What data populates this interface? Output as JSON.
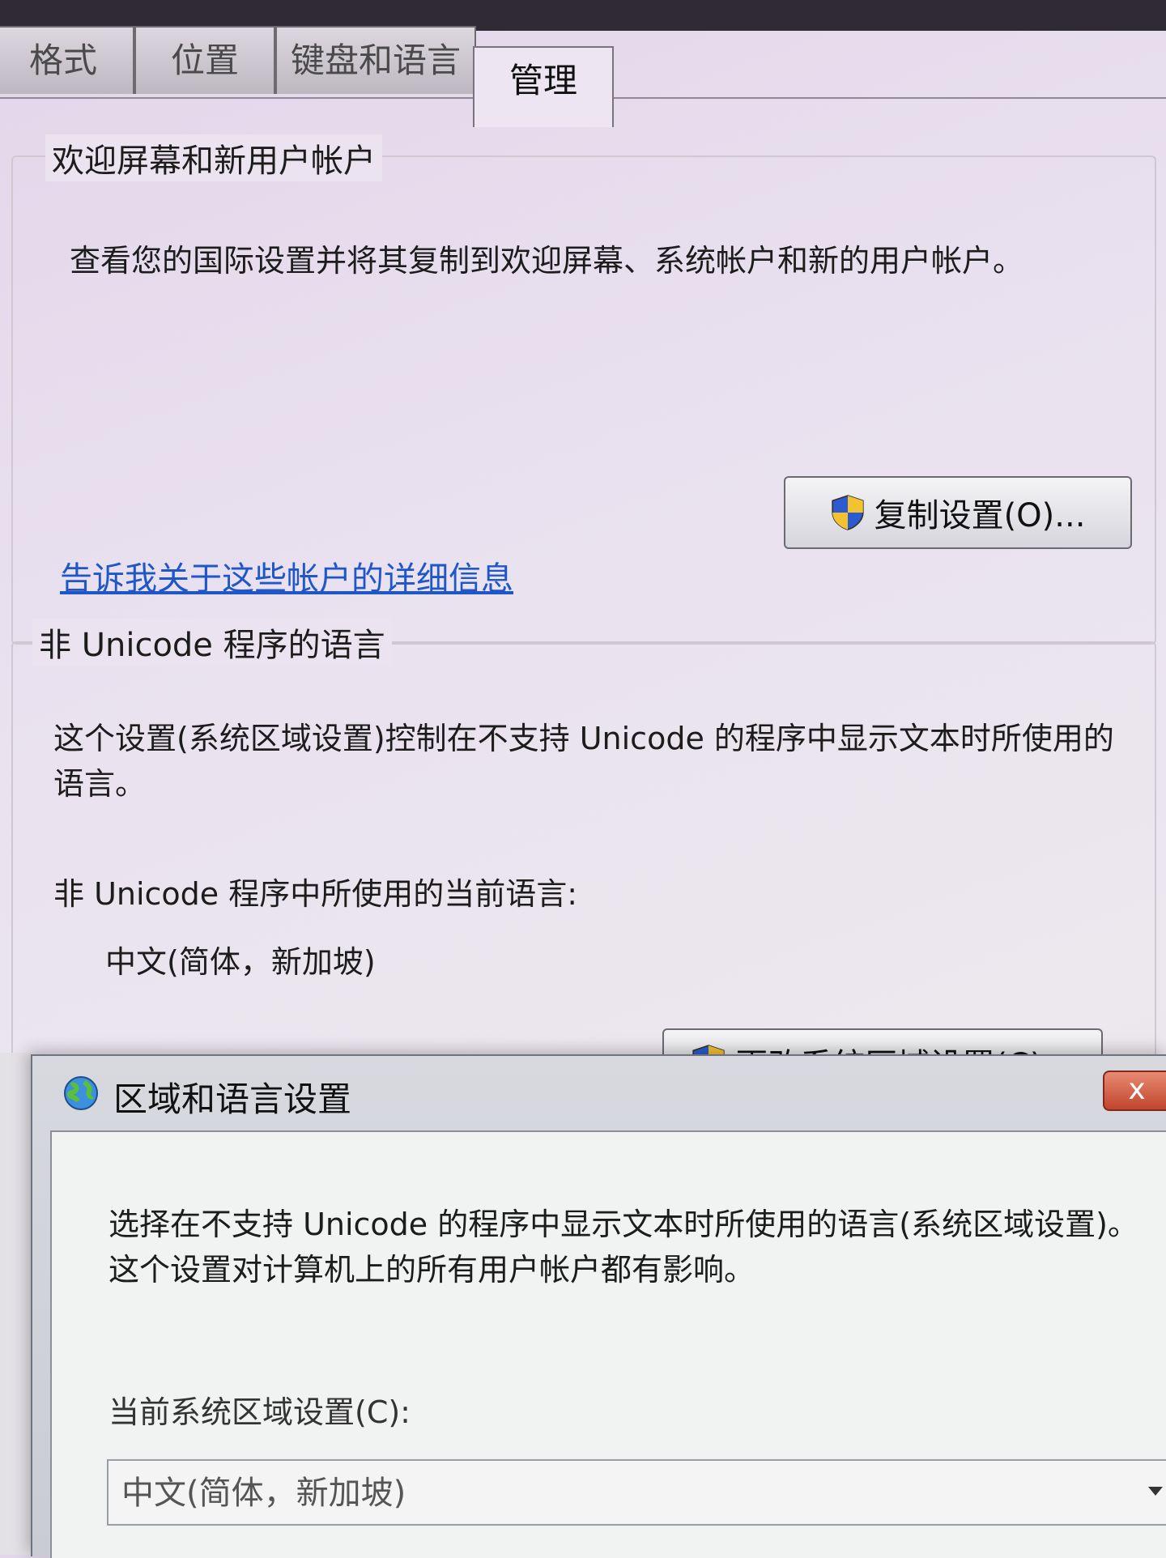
{
  "tabs": [
    {
      "label": "格式"
    },
    {
      "label": "位置"
    },
    {
      "label": "键盘和语言"
    },
    {
      "label": "管理"
    }
  ],
  "welcome_group": {
    "title": "欢迎屏幕和新用户帐户",
    "description": "查看您的国际设置并将其复制到欢迎屏幕、系统帐户和新的用户帐户。",
    "copy_button": "复制设置(O)...",
    "link": "告诉我关于这些帐户的详细信息"
  },
  "unicode_group": {
    "title": "非 Unicode 程序的语言",
    "description": "这个设置(系统区域设置)控制在不支持 Unicode 的程序中显示文本时所使用的语言。",
    "current_label": "非 Unicode 程序中所使用的当前语言:",
    "current_value": "中文(简体，新加坡)",
    "change_button": "更改系统区域设置(C)..."
  },
  "dialog": {
    "title": "区域和语言设置",
    "close": "x",
    "description": "选择在不支持 Unicode 的程序中显示文本时所使用的语言(系统区域设置)。这个设置对计算机上的所有用户帐户都有影响。",
    "locale_label": "当前系统区域设置(C):",
    "locale_value": "中文(简体，新加坡)"
  },
  "colors": {
    "link": "#1f56c8",
    "close_button": "#c0452c"
  }
}
